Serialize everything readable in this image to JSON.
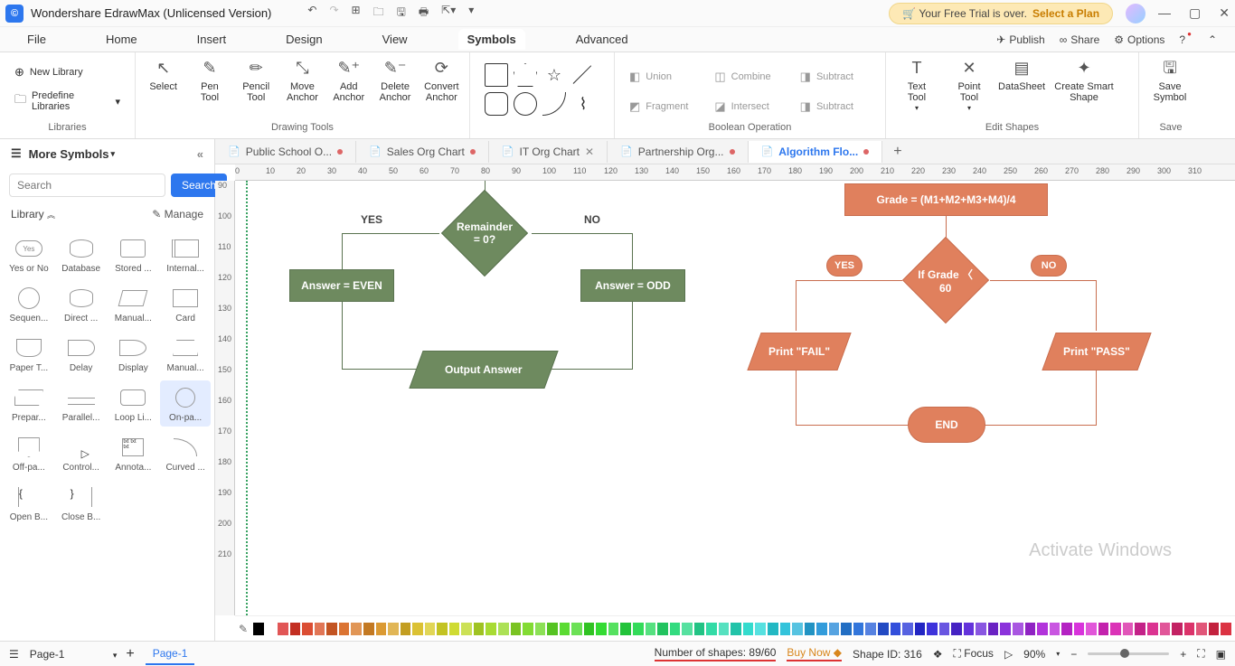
{
  "title": "Wondershare EdrawMax (Unlicensed Version)",
  "trial_notice_prefix": "🛒 Your Free Trial is over. ",
  "trial_notice_action": "Select a Plan",
  "menu": {
    "file": "File",
    "home": "Home",
    "insert": "Insert",
    "design": "Design",
    "view": "View",
    "symbols": "Symbols",
    "advanced": "Advanced"
  },
  "rightlinks": {
    "publish": "Publish",
    "share": "Share",
    "options": "Options"
  },
  "ribbon": {
    "libraries": {
      "new_library": "New Library",
      "predefine": "Predefine Libraries",
      "label": "Libraries"
    },
    "drawing": {
      "select": "Select",
      "pen": "Pen\nTool",
      "pencil": "Pencil\nTool",
      "move": "Move\nAnchor",
      "add": "Add\nAnchor",
      "delete": "Delete\nAnchor",
      "convert": "Convert\nAnchor",
      "label": "Drawing Tools"
    },
    "boolean": {
      "union": "Union",
      "combine": "Combine",
      "subtract": "Subtract",
      "fragment": "Fragment",
      "intersect": "Intersect",
      "subtract2": "Subtract",
      "label": "Boolean Operation"
    },
    "edit": {
      "text": "Text\nTool",
      "point": "Point\nTool",
      "datasheet": "DataSheet",
      "smart": "Create Smart\nShape",
      "label": "Edit Shapes"
    },
    "save": {
      "save": "Save\nSymbol",
      "label": "Save"
    }
  },
  "leftpanel": {
    "title": "More Symbols",
    "search_btn": "Search",
    "search_placeholder": "Search",
    "library": "Library",
    "manage": "Manage",
    "shapes": [
      "Yes or No",
      "Database",
      "Stored ...",
      "Internal...",
      "Sequen...",
      "Direct ...",
      "Manual...",
      "Card",
      "Paper T...",
      "Delay",
      "Display",
      "Manual...",
      "Prepar...",
      "Parallel...",
      "Loop Li...",
      "On-pa...",
      "Off-pa...",
      "Control...",
      "Annota...",
      "Curved ...",
      "Open B...",
      "Close B..."
    ]
  },
  "tabs": [
    {
      "name": "Public School O...",
      "dirty": true
    },
    {
      "name": "Sales Org Chart",
      "dirty": true
    },
    {
      "name": "IT Org Chart",
      "dirty": false,
      "closable": true
    },
    {
      "name": "Partnership Org...",
      "dirty": true
    },
    {
      "name": "Algorithm Flo...",
      "dirty": true,
      "active": true
    }
  ],
  "ruler_h": [
    0,
    10,
    20,
    30,
    40,
    50,
    60,
    70,
    80,
    90,
    100,
    110,
    120,
    130,
    140,
    150,
    160,
    170,
    180,
    190,
    200,
    210,
    220,
    230,
    240,
    250,
    260,
    270,
    280,
    290,
    300,
    310
  ],
  "ruler_v": [
    90,
    100,
    110,
    120,
    130,
    140,
    150,
    160,
    170,
    180,
    190,
    200,
    210
  ],
  "flowchart": {
    "remainder": "Remainder = 0?",
    "yes": "YES",
    "no": "NO",
    "even": "Answer = EVEN",
    "odd": "Answer = ODD",
    "output": "Output Answer",
    "grade": "Grade =  (M1+M2+M3+M4)/4",
    "ifgrade": "If Grade 〈 60",
    "fail": "Print \"FAIL\"",
    "pass": "Print \"PASS\"",
    "end": "END"
  },
  "statusbar": {
    "page": "Page-1",
    "numshapes": "Number of shapes: 89/60",
    "buynow": "Buy Now",
    "shapeid": "Shape ID: 316",
    "focus": "Focus",
    "zoom": "90%"
  },
  "watermark": "Activate Windows"
}
